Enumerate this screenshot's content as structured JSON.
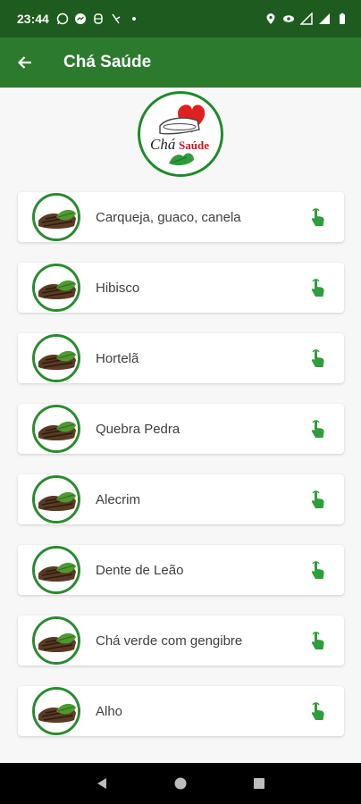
{
  "status_bar": {
    "time": "23:44",
    "left_icons": [
      "whatsapp-icon",
      "messenger-icon",
      "notification-icon",
      "media-icon",
      "dot-icon"
    ],
    "right_icons": [
      "location-icon",
      "eye-icon",
      "signal-icon",
      "signal-icon",
      "battery-icon"
    ]
  },
  "app_bar": {
    "title": "Chá Saúde",
    "back_icon": "arrow-back-icon"
  },
  "logo": {
    "text_cha": "Chá",
    "text_saude": "Saúde"
  },
  "items": [
    {
      "label": "Carqueja, guaco, canela"
    },
    {
      "label": "Hibisco"
    },
    {
      "label": "Hortelã"
    },
    {
      "label": "Quebra Pedra"
    },
    {
      "label": "Alecrim"
    },
    {
      "label": "Dente de Leão"
    },
    {
      "label": "Chá verde com gengibre"
    },
    {
      "label": "Alho"
    }
  ],
  "colors": {
    "status_bar": "#1e5b1f",
    "app_bar": "#2c7a2e",
    "accent_green": "#2a8a2f"
  }
}
